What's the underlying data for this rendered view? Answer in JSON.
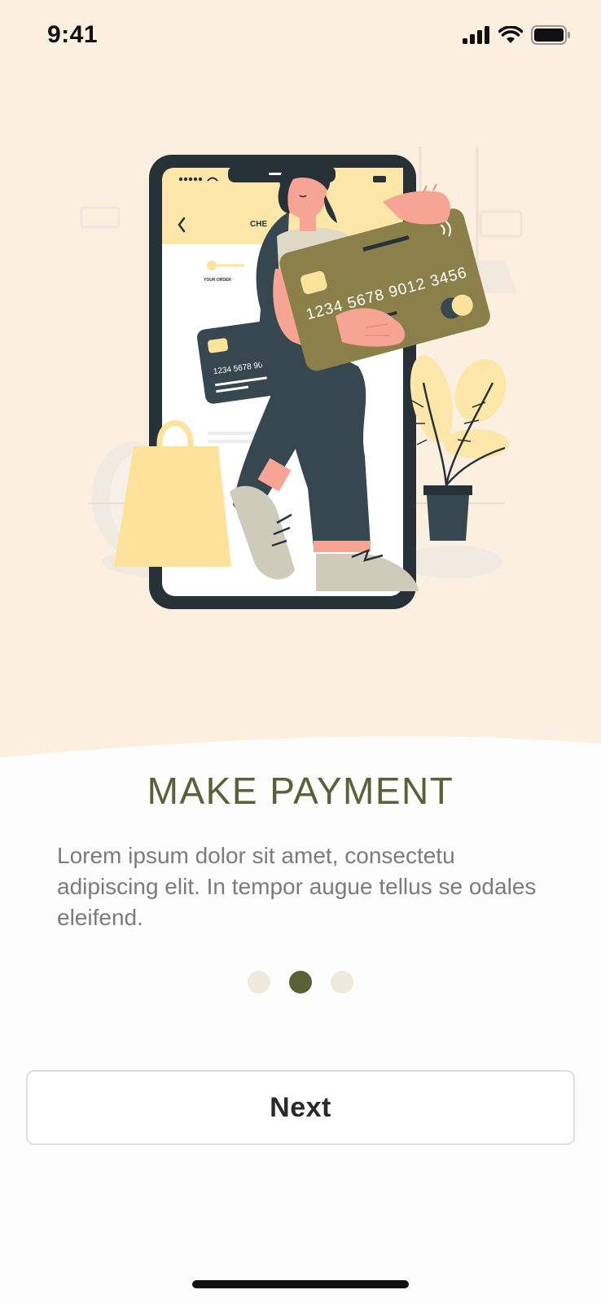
{
  "status_bar": {
    "time": "9:41",
    "icons": [
      "signal-icon",
      "wifi-icon",
      "battery-icon"
    ]
  },
  "illustration": {
    "description_icon": "payment-illustration",
    "phone": {
      "checkout_label": "CHE",
      "step_label": "YOUR ORDER"
    },
    "big_card_number": "1234 5678 9012 3456",
    "small_card_number": "1234 5678 90"
  },
  "onboarding": {
    "title": "MAKE PAYMENT",
    "description": "Lorem ipsum dolor sit amet, consectetu adipiscing elit. In tempor augue tellus se odales eleifend.",
    "pagination": {
      "total": 3,
      "active_index": 1
    }
  },
  "actions": {
    "next_label": "Next"
  },
  "colors": {
    "hero_background": "#fbefe0",
    "accent": "#5a6136",
    "dot_inactive": "#efe8dc",
    "card_gold": "#8b8049",
    "bag_yellow": "#fde4a4",
    "dark_navy": "#263238"
  }
}
